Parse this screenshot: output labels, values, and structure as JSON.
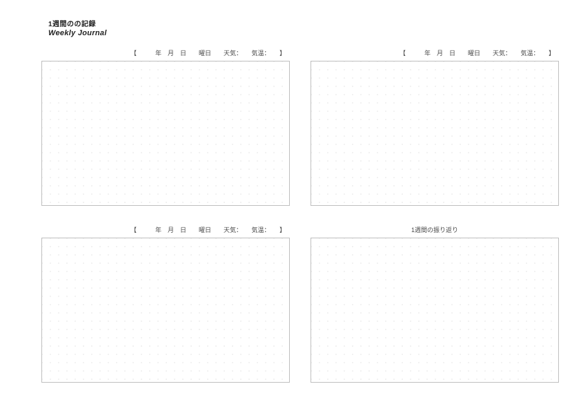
{
  "header": {
    "jp": "1週間のの記録",
    "en": "Weekly Journal"
  },
  "panels": {
    "top_left": {
      "label": "【　　　年　月　日　　曜日　　天気：　　気温：　　】"
    },
    "top_right": {
      "label": "【　　　年　月　日　　曜日　　天気：　　気温：　　】"
    },
    "bottom_left": {
      "label": "【　　　年　月　日　　曜日　　天気：　　気温：　　】"
    },
    "bottom_right": {
      "label": "1週間の振り返り"
    }
  }
}
